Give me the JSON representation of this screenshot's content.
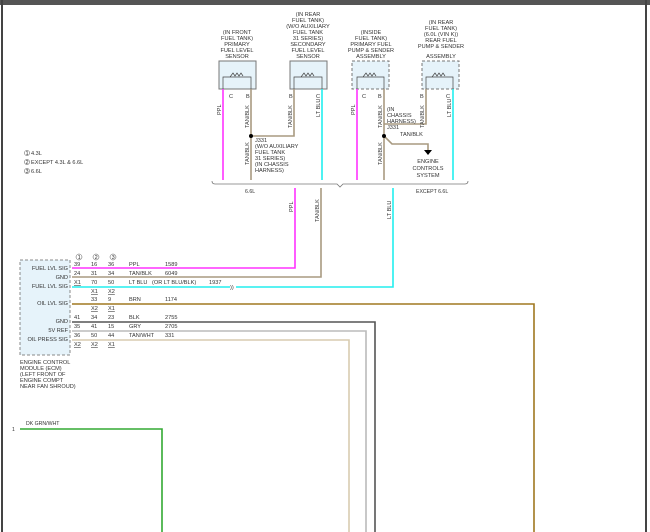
{
  "legend": [
    "4.3L",
    "EXCEPT 4.3L & 6.6L",
    "6.6L"
  ],
  "legend_numbers": [
    "1",
    "2",
    "3"
  ],
  "components": {
    "front_sensor": [
      "(IN FRONT",
      "FUEL TANK)",
      "PRIMARY",
      "FUEL LEVEL",
      "SENSOR"
    ],
    "secondary_sensor": [
      "(IN REAR",
      "FUEL TANK)",
      "(W/O AUXILIARY",
      "FUEL TANK",
      "31 SERIES)",
      "SECONDARY",
      "FUEL LEVEL",
      "SENSOR"
    ],
    "primary_pump": [
      "(INSIDE",
      "FUEL TANK)",
      "PRIMARY FUEL",
      "PUMP & SENDER",
      "ASSEMBLY"
    ],
    "rear_pump": [
      "(IN REAR",
      "FUEL TANK)",
      "(6.0L (VIN K))",
      "REAR FUEL",
      "PUMP & SENDER",
      "ASSEMBLY"
    ],
    "pin_c": "C",
    "pin_b": "B"
  },
  "wires": {
    "ppl": "PPL",
    "tanblk": "TAN/BLK",
    "ltblu": "LT BLU",
    "dkgrnwht": "DK GRN/WHT"
  },
  "splice_left": [
    "J331",
    "(W/O AUXILIARY",
    "FUEL TANK",
    "31 SERIES)",
    "(IN CHASSIS",
    "HARNESS)"
  ],
  "splice_right": [
    "(IN",
    "CHASSIS",
    "HARNESS)",
    "J331"
  ],
  "engine_controls": [
    "ENGINE",
    "CONTROLS",
    "SYSTEM"
  ],
  "brace_labels": {
    "left": "6.6L",
    "right": "EXCEPT 6.6L"
  },
  "ecm": {
    "pins": [
      "FUEL LVL SIG",
      "GND",
      "FUEL LVL SIG",
      "OIL LVL SIG",
      "GND",
      "5V REF",
      "OIL PRESS SIG"
    ],
    "label": [
      "ENGINE CONTROL",
      "MODULE (ECM)",
      "(LEFT FRONT OF",
      "ENGINE COMPT",
      "NEAR FAN SHROUD)"
    ]
  },
  "table": [
    [
      "39",
      "16",
      "36",
      "PPL",
      "1589"
    ],
    [
      "24",
      "31",
      "34",
      "TAN/BLK",
      "6049"
    ],
    [
      "X1",
      "70",
      "50",
      "LT BLU",
      "(OR LT BLU/BLK)",
      "1937"
    ],
    [
      "",
      "X1",
      "X2"
    ],
    [
      "",
      "33",
      "9",
      "BRN",
      "1174"
    ],
    [
      "",
      "X2",
      "X1"
    ],
    [
      "41",
      "34",
      "23",
      "BLK",
      "2755"
    ],
    [
      "35",
      "41",
      "15",
      "GRY",
      "2705"
    ],
    [
      "36",
      "50",
      "44",
      "TAN/WHT",
      "331"
    ],
    [
      "X2",
      "X2",
      "X1"
    ]
  ],
  "bottom_pin": "1",
  "colors": {
    "ppl": "#ff33ff",
    "tanblk": "#a89a80",
    "ltblu": "#22eeee",
    "brn": "#a07820",
    "blk": "#555555",
    "gry": "#bbbbbb",
    "tanwht": "#d8ccb0",
    "grn": "#33aa33",
    "box": "#e6f3fa"
  }
}
